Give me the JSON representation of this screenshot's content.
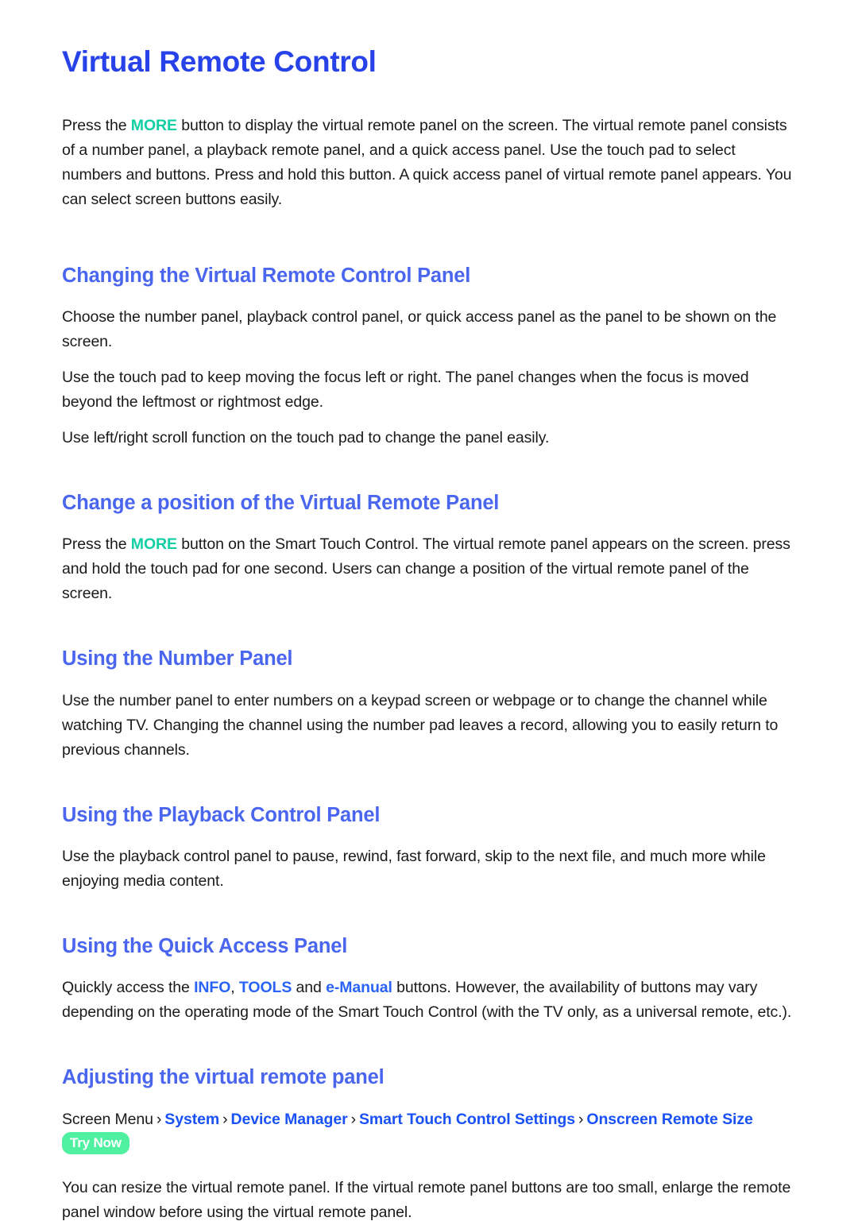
{
  "document": {
    "title": "Virtual Remote Control",
    "intro": {
      "before": "Press the ",
      "keyword": "MORE",
      "after": " button to display the virtual remote panel on the screen. The virtual remote panel consists of a number panel, a playback remote panel, and a quick access panel. Use the touch pad to select numbers and buttons. Press and hold this button. A quick access panel of virtual remote panel appears. You can select screen buttons easily."
    },
    "sections": [
      {
        "heading": "Changing the Virtual Remote Control Panel",
        "paragraphs": [
          "Choose the number panel, playback control panel, or quick access panel as the panel to be shown on the screen.",
          "Use the touch pad to keep moving the focus left or right. The panel changes when the focus is moved beyond the leftmost or rightmost edge.",
          "Use left/right scroll function on the touch pad to change the panel easily."
        ]
      },
      {
        "heading": "Change a position of the Virtual Remote Panel",
        "paragraph_before": "Press the ",
        "paragraph_keyword": "MORE",
        "paragraph_after": " button on the Smart Touch Control. The virtual remote panel appears on the screen. press and hold the touch pad for one second. Users can change a position of the virtual remote panel of the screen."
      },
      {
        "heading": "Using the Number Panel",
        "paragraphs": [
          "Use the number panel to enter numbers on a keypad screen or webpage or to change the channel while watching TV. Changing the channel using the number pad leaves a record, allowing you to easily return to previous channels."
        ]
      },
      {
        "heading": "Using the Playback Control Panel",
        "paragraphs": [
          "Use the playback control panel to pause, rewind, fast forward, skip to the next file, and much more while enjoying media content."
        ]
      },
      {
        "heading": "Using the Quick Access Panel",
        "quick_access": {
          "t0": "Quickly access the ",
          "k1": "INFO",
          "t1": ", ",
          "k2": "TOOLS",
          "t2": " and ",
          "k3": "e-Manual",
          "t3": " buttons. However, the availability of buttons may vary depending on the operating mode of the Smart Touch Control (with the TV only, as a universal remote, etc.)."
        }
      },
      {
        "heading": "Adjusting the virtual remote panel",
        "breadcrumb": {
          "root": "Screen Menu",
          "sep": "›",
          "items": [
            "System",
            "Device Manager",
            "Smart Touch Control Settings",
            "Onscreen Remote Size"
          ],
          "badge": "Try Now"
        },
        "paragraphs": [
          "You can resize the virtual remote panel. If the virtual remote panel buttons are too small, enlarge the remote panel window before using the virtual remote panel."
        ]
      }
    ],
    "colors": {
      "title_blue": "#2742e8",
      "heading_blue": "#4a66ef",
      "keyword_teal": "#12cfa3",
      "keyword_blue": "#2a63f5",
      "breadcrumb_blue": "#1a51f7",
      "badge_green": "#4ff0a0"
    }
  }
}
